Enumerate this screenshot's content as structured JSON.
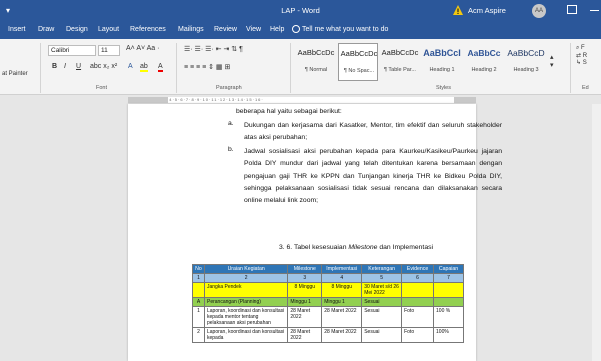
{
  "window": {
    "title": "LAP - Word",
    "quick_access": "▾",
    "user": "Acm Aspire",
    "avatar": "AA"
  },
  "tabs": [
    "Insert",
    "Draw",
    "Design",
    "Layout",
    "References",
    "Mailings",
    "Review",
    "View",
    "Help"
  ],
  "tell_me": "Tell me what you want to do",
  "ribbon": {
    "format_painter": "at Painter",
    "font_name": "Calibri",
    "font_size": "11",
    "font_group_label": "Font",
    "paragraph_group_label": "Paragraph",
    "styles_group_label": "Styles",
    "editing_label": "Ed",
    "styles": [
      {
        "preview": "AaBbCcDc",
        "name": "¶ Normal"
      },
      {
        "preview": "AaBbCcDc",
        "name": "¶ No Spac..."
      },
      {
        "preview": "AaBbCcDc",
        "name": "¶ Table Par..."
      },
      {
        "preview": "AaBbCcI",
        "name": "Heading 1"
      },
      {
        "preview": "AaBbCc",
        "name": "Heading 2"
      },
      {
        "preview": "AaBbCcD",
        "name": "Heading 3"
      }
    ],
    "bold": "B",
    "italic": "I",
    "underline": "U"
  },
  "ruler_text": "·2·1·2·1·1·2·3·4·5·6·7·8·9·10·11·12·13·14·15·16·",
  "document": {
    "intro": "beberapa hal yaitu sebagai berikut:",
    "items": [
      {
        "marker": "a.",
        "text": "Dukungan dan kerjasama dari Kasatker, Mentor, tim efektif dan seluruh stakeholder atas aksi perubahan;"
      },
      {
        "marker": "b.",
        "text": "Jadwal sosialisasi aksi perubahan kepada para Kaurkeu/Kasikeu/Paurkeu jajaran Polda DIY mundur dari jadwal yang telah ditentukan karena bersamaan dengan pengajuan gaji THR ke KPPN dan Tunjangan kinerja THR ke Bidkeu Polda DIY, sehingga pelaksanaan sosialisasi tidak sesuai rencana dan dilaksanakan secara online melalui link zoom;"
      }
    ],
    "caption_prefix": "3. 6. Tabel kesesuaian ",
    "caption_em": "Milestone",
    "caption_suffix": " dan Implementasi"
  },
  "table": {
    "headers": [
      "No",
      "Uraian Kegiatan",
      "Milestone",
      "Implementasi",
      "Keterangan",
      "Evidence",
      "Capaian"
    ],
    "numbers": [
      "1",
      "2",
      "3",
      "4",
      "5",
      "6",
      "7"
    ],
    "rows": [
      {
        "style": "yel",
        "cells": [
          "",
          "Jangka Pendek",
          "8 Minggu",
          "8 Minggu",
          "30 Maret s/d 26 Mei 2022",
          "",
          ""
        ]
      },
      {
        "style": "grn",
        "cells": [
          "A",
          "Perancangan (Planning)",
          "Minggu 1",
          "Minggu 1",
          "Sesuai",
          "",
          ""
        ]
      },
      {
        "style": "",
        "cells": [
          "1",
          "Laporan, koordinasi dan konsultasi kepada mentor tentang pelaksanaan aksi perubahan",
          "28 Maret 2022",
          "28 Maret 2022",
          "Sesuai",
          "Foto",
          "100 %"
        ]
      },
      {
        "style": "",
        "cells": [
          "2",
          "Laporan, koordinasi dan konsultasi kepada",
          "28 Maret 2022",
          "28 Maret 2022",
          "Sesuai",
          "Foto",
          "100%"
        ]
      }
    ]
  }
}
